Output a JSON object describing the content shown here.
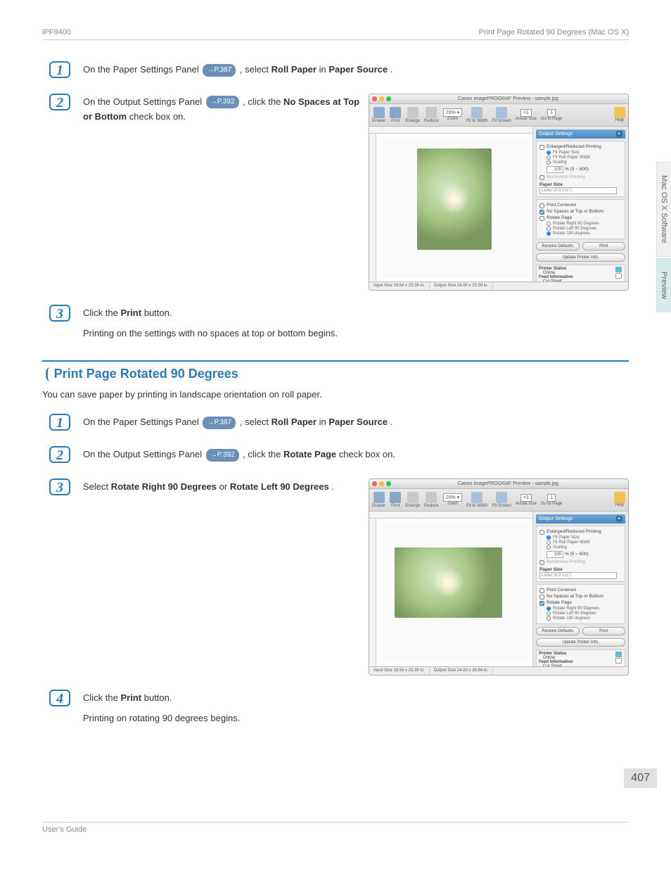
{
  "header": {
    "left": "iPF9400",
    "right": "Print Page Rotated 90 Degrees (Mac OS X)"
  },
  "sideTabs": {
    "tab1": "Mac OS X Software",
    "tab2": "Preview"
  },
  "sec1": {
    "step1": {
      "num": "1",
      "pre": "On the Paper Settings Panel ",
      "ref": "→P.387",
      "mid": " , select ",
      "bold1": "Roll Paper",
      "mid2": " in ",
      "bold2": "Paper Source",
      "post": "."
    },
    "step2": {
      "num": "2",
      "pre": "On the Output Settings Panel ",
      "ref": "→P.392",
      "mid": " , click the ",
      "bold1": "No Spaces at Top or Bottom",
      "post": " check box on."
    },
    "step3": {
      "num": "3",
      "line1a": "Click the ",
      "line1b": "Print",
      "line1c": " button.",
      "line2": "Printing on the settings with no spaces at top or bottom begins."
    }
  },
  "section2": {
    "title": "Print Page Rotated 90 Degrees",
    "desc": "You can save paper by printing in landscape orientation on roll paper.",
    "step1": {
      "num": "1",
      "pre": "On the Paper Settings Panel ",
      "ref": "→P.387",
      "mid": " , select ",
      "bold1": "Roll Paper",
      "mid2": " in ",
      "bold2": "Paper Source",
      "post": "."
    },
    "step2": {
      "num": "2",
      "pre": "On the Output Settings Panel ",
      "ref": "→P.392",
      "mid": " , click the ",
      "bold1": "Rotate Page",
      "post": " check box on."
    },
    "step3": {
      "num": "3",
      "pre": "Select ",
      "bold1": "Rotate Right 90 Degrees",
      "mid": " or ",
      "bold2": "Rotate Left 90 Degrees",
      "post": "."
    },
    "step4": {
      "num": "4",
      "line1a": "Click the ",
      "line1b": "Print",
      "line1c": " button.",
      "line2": "Printing on rotating 90 degrees begins."
    }
  },
  "window": {
    "title": "Canon imagePROGRAF Preview - sample.jpg",
    "toolbar": {
      "drawer": "Drawer",
      "print": "Print",
      "enlarge": "Enlarge",
      "reduce": "Reduce",
      "zoom": "Zoom",
      "zoomValue": "20% ▾",
      "fitWidth": "Fit to Width",
      "fitScreen": "Fit Screen",
      "actualSize": "Actual Size",
      "actualBtn": "×1",
      "pageValue": "1",
      "goto": "Go to Page",
      "help": "Help"
    },
    "panel": {
      "header": "Output Settings",
      "enlargedReduced": "Enlarged/Reduced Printing",
      "fitPaperSize": "Fit Paper Size",
      "fitRollWidth": "Fit Roll Paper Width",
      "scaling": "Scaling",
      "scalingValue": "100",
      "scalingRange": "% (5 ~ 600)",
      "borderless": "Borderless Printing",
      "paperSize": "Paper Size",
      "paperSizeValue": "Letter (8.5\"x11\")",
      "printCentered": "Print Centered",
      "noSpaces": "No Spaces at Top or Bottom",
      "rotatePage": "Rotate Page",
      "rotateRight": "Rotate Right 90 Degrees",
      "rotateLeft": "Rotate Left 90 Degrees",
      "rotate180": "Rotate 180 degrees",
      "restoreDefaults": "Restore Defaults",
      "print": "Print",
      "updatePrinter": "Update Printer Info.",
      "printerStatus": "Printer Status",
      "online": "Online",
      "feedInfo": "Feed Information",
      "cutSheet": "Cut Sheet"
    },
    "status1": {
      "input": "Input Size 16.54 x 23.39 in.",
      "output": "Output Size 24.00 x 23.39 in."
    },
    "status2": {
      "input": "Input Size 16.54 x 23.39 in.",
      "output": "Output Size 24.00 x 16.54 in."
    }
  },
  "pageNum": "407",
  "footer": "User's Guide"
}
